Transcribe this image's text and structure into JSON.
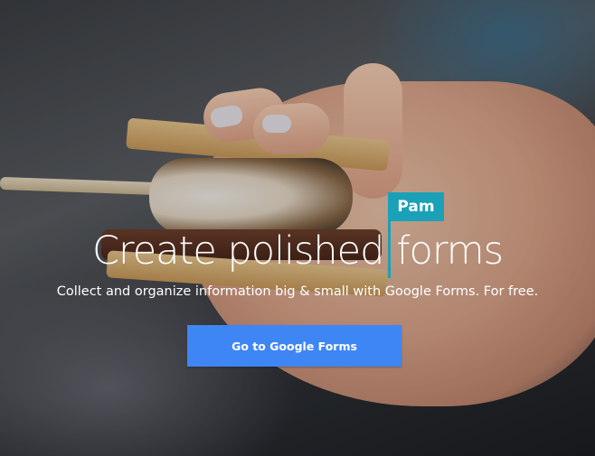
{
  "hero": {
    "headline_before": "Create polished",
    "headline_after": "forms",
    "collaborator_name": "Pam",
    "subtitle": "Collect and organize information big & small with Google Forms. For free.",
    "cta_label": "Go to Google Forms"
  },
  "colors": {
    "cursor": "#1aa1b8",
    "cta_background": "#3f86f5",
    "text": "#ffffff"
  },
  "icons": []
}
